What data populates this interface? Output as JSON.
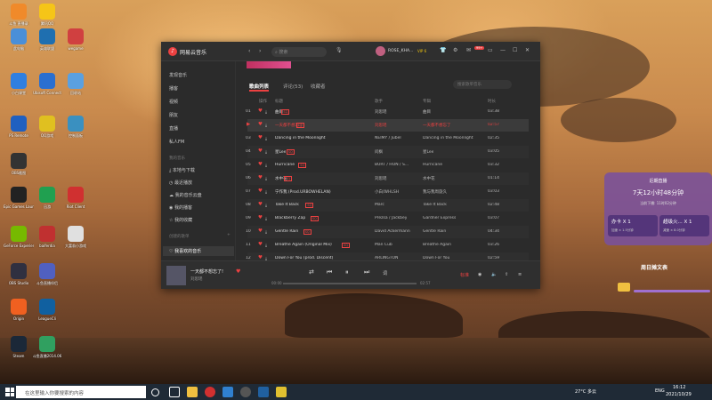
{
  "desktop": {
    "icons": [
      {
        "label": "斗鱼 直播录",
        "color": "#f08a2a"
      },
      {
        "label": "腾讯QQ",
        "color": "#f5c518"
      },
      {
        "label": "此电脑",
        "color": "#4a8fd8"
      },
      {
        "label": "英雄联盟",
        "color": "#1f6fb0"
      },
      {
        "label": "wegame",
        "color": "#d04040"
      },
      {
        "label": "小白课堂",
        "color": "#2f7fe0"
      },
      {
        "label": "Ubisoft Connect",
        "color": "#2a6fd0"
      },
      {
        "label": "回收站",
        "color": "#5aa0e0"
      },
      {
        "label": "PS Remote",
        "color": "#2060c0"
      },
      {
        "label": "QQ游戏",
        "color": "#e0c020"
      },
      {
        "label": "控制面板",
        "color": "#3a90c0"
      },
      {
        "label": "OBS截图",
        "color": "#333333"
      },
      {
        "label": "Epic Games Launcher",
        "color": "#222222"
      },
      {
        "label": "迅游",
        "color": "#20a050"
      },
      {
        "label": "Riot Client",
        "color": "#d03030"
      },
      {
        "label": "GeForce Experience",
        "color": "#76b900"
      },
      {
        "label": "baiferdia",
        "color": "#c03030"
      },
      {
        "label": "大富翁小游戏",
        "color": "#e0e0e0"
      },
      {
        "label": "OBS Studio",
        "color": "#303040"
      },
      {
        "label": "斗鱼直播伴侣",
        "color": "#5060c0"
      },
      {
        "label": "Origin",
        "color": "#f06020"
      },
      {
        "label": "LeagueCli",
        "color": "#1060a0"
      },
      {
        "label": "Steam",
        "color": "#1b2838"
      },
      {
        "label": "斗鱼直播2014.06",
        "color": "#30a060"
      }
    ]
  },
  "app": {
    "name": "网易云音乐",
    "search_placeholder": "搜索",
    "user": "ROSE_KHA...",
    "vip": "VIP 6",
    "badge": "99+",
    "sidebar": {
      "items": [
        "发现音乐",
        "播客",
        "视频",
        "朋友",
        "直播",
        "私人FM"
      ],
      "section_label": "我的音乐",
      "my_items": [
        "本地与下载",
        "最近播放",
        "我的音乐云盘",
        "我的播客",
        "我的收藏"
      ],
      "created_label": "创建的歌单",
      "playlist": "我喜欢的音乐"
    },
    "tabs": [
      "歌曲列表",
      "评论(53)",
      "收藏者"
    ],
    "filter_placeholder": "搜索歌单音乐",
    "columns": [
      "操作",
      "标题",
      "歌手",
      "专辑",
      "时长"
    ],
    "rows": [
      {
        "num": "01",
        "title": "曲目",
        "tag": "SQ",
        "artist": "刘思瑶",
        "album": "曲目",
        "time": "03:38"
      },
      {
        "num": "",
        "title": "一天都不想忘了!",
        "tag": "SQ",
        "artist": "刘思瑶",
        "album": "一天都不想忘了",
        "time": "02:57"
      },
      {
        "num": "03",
        "title": "Dancing in the Moonlight",
        "tag": "",
        "artist": "NEIMY / Jubël",
        "album": "Dancing in the Moonlight",
        "time": "02:35"
      },
      {
        "num": "04",
        "title": "星Lee",
        "tag": "SQ",
        "artist": "问枫",
        "album": "星Lee",
        "time": "03:05"
      },
      {
        "num": "05",
        "title": "Hurricane",
        "tag": "SQ",
        "artist": "BURT / HON / S...",
        "album": "Hurricane",
        "time": "03:32"
      },
      {
        "num": "06",
        "title": "水中花",
        "tag": "SQ",
        "artist": "刘思瑶",
        "album": "水中花",
        "time": "01:14"
      },
      {
        "num": "07",
        "title": "宁作我 (Prod.URBOWHELAN)",
        "tag": "",
        "artist": "小白/WHLSH",
        "album": "我与我周旋久",
        "time": "03:03"
      },
      {
        "num": "08",
        "title": "Take It Back",
        "tag": "SQ",
        "artist": "Marc",
        "album": "Take It Back",
        "time": "02:48"
      },
      {
        "num": "09",
        "title": "Blackberry Zap",
        "tag": "SQ",
        "artist": "Prezsa / Jackbey",
        "album": "Gardner Express",
        "time": "03:07"
      },
      {
        "num": "10",
        "title": "Gentle Rain",
        "tag": "SQ",
        "artist": "David Ackermann",
        "album": "Gentle Rain",
        "time": "04:34"
      },
      {
        "num": "11",
        "title": "Breathe Again (Original Mix)",
        "tag": "SQ",
        "artist": "Man Cub",
        "album": "Breathe Again",
        "time": "03:26"
      },
      {
        "num": "12",
        "title": "Down For You (prod. Discent)",
        "tag": "",
        "artist": "ARLINGTON",
        "album": "Down For You",
        "time": "02:59"
      }
    ],
    "player": {
      "title": "一天都不想忘了!",
      "artist": "刘思瑶",
      "time_current": "00:00",
      "time_total": "02:57",
      "progress": 0.0,
      "quality": "标准"
    }
  },
  "overlay": {
    "live_title": "近期直播",
    "live_countdown": "7天12小时48分钟",
    "live_sub": "当前下播: 11时02分钟",
    "card1": "办卡 X 1",
    "card2": "超级火... X 1",
    "card1_sub": "加速 × 1.5分钟",
    "card2_sub": "减速 × 8.0分钟",
    "dm_title": "周日摊文表"
  },
  "taskbar": {
    "search_placeholder": "在这里输入你要搜索的内容",
    "weather": "27°C 多云",
    "lang": "ENG",
    "time": "16:12",
    "date": "2021/10/29"
  }
}
